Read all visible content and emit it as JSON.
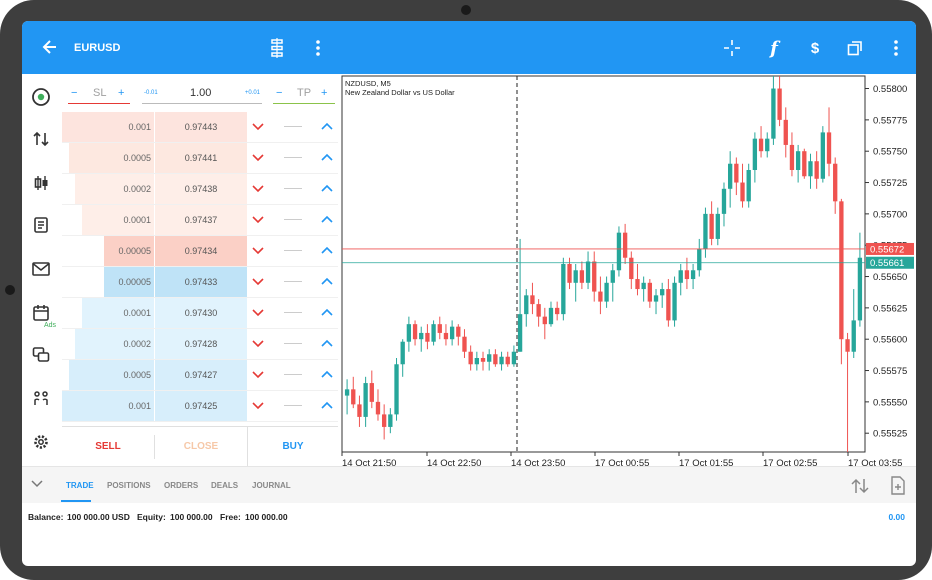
{
  "topbar": {
    "symbol": "EURUSD"
  },
  "sidebar": {
    "ads_label": "Ads"
  },
  "trade": {
    "sl_label": "SL",
    "tp_label": "TP",
    "lot_value": "1.00",
    "lot_minus": "-0.01",
    "lot_plus": "+0.01",
    "rows": [
      {
        "volume": "0.001",
        "price": "0.97443"
      },
      {
        "volume": "0.0005",
        "price": "0.97441"
      },
      {
        "volume": "0.0002",
        "price": "0.97438"
      },
      {
        "volume": "0.0001",
        "price": "0.97437"
      },
      {
        "volume": "0.00005",
        "price": "0.97434"
      },
      {
        "volume": "0.00005",
        "price": "0.97433"
      },
      {
        "volume": "0.0001",
        "price": "0.97430"
      },
      {
        "volume": "0.0002",
        "price": "0.97428"
      },
      {
        "volume": "0.0005",
        "price": "0.97427"
      },
      {
        "volume": "0.001",
        "price": "0.97425"
      }
    ],
    "sell_label": "SELL",
    "close_label": "CLOSE",
    "buy_label": "BUY"
  },
  "chart_data": {
    "type": "candlestick",
    "symbol_line": "NZDUSD, M5",
    "description_line": "New Zealand Dollar vs US Dollar",
    "y_ticks": [
      "0.55800",
      "0.55775",
      "0.55750",
      "0.55725",
      "0.55700",
      "0.55675",
      "0.55650",
      "0.55625",
      "0.55600",
      "0.55575",
      "0.55550",
      "0.55525"
    ],
    "ylim": [
      0.5551,
      0.5581
    ],
    "x_ticks": [
      "14 Oct 21:50",
      "14 Oct 22:50",
      "14 Oct 23:50",
      "17 Oct 00:55",
      "17 Oct 01:55",
      "17 Oct 02:55",
      "17 Oct 03:55"
    ],
    "ask_price": "0.55672",
    "bid_price": "0.55661",
    "up_color": "#26a69a",
    "down_color": "#ef5350",
    "ohlc": [
      [
        0.55555,
        0.55568,
        0.5554,
        0.5556
      ],
      [
        0.5556,
        0.5557,
        0.55545,
        0.55548
      ],
      [
        0.55548,
        0.55555,
        0.5553,
        0.55538
      ],
      [
        0.55538,
        0.5557,
        0.5553,
        0.55565
      ],
      [
        0.55565,
        0.55575,
        0.55545,
        0.5555
      ],
      [
        0.5555,
        0.5556,
        0.55535,
        0.5554
      ],
      [
        0.5554,
        0.55548,
        0.5552,
        0.5553
      ],
      [
        0.5553,
        0.55545,
        0.55525,
        0.5554
      ],
      [
        0.5554,
        0.55585,
        0.55535,
        0.5558
      ],
      [
        0.5558,
        0.556,
        0.5557,
        0.55598
      ],
      [
        0.55598,
        0.55618,
        0.5559,
        0.55612
      ],
      [
        0.55612,
        0.55615,
        0.55595,
        0.556
      ],
      [
        0.556,
        0.5561,
        0.5559,
        0.55605
      ],
      [
        0.55605,
        0.55612,
        0.55592,
        0.55598
      ],
      [
        0.55598,
        0.55615,
        0.55595,
        0.55612
      ],
      [
        0.55612,
        0.55618,
        0.556,
        0.55605
      ],
      [
        0.55605,
        0.55612,
        0.55595,
        0.556
      ],
      [
        0.556,
        0.55615,
        0.55595,
        0.5561
      ],
      [
        0.5561,
        0.55612,
        0.55595,
        0.55602
      ],
      [
        0.55602,
        0.55608,
        0.55585,
        0.5559
      ],
      [
        0.5559,
        0.55595,
        0.55575,
        0.5558
      ],
      [
        0.5558,
        0.5559,
        0.55575,
        0.55585
      ],
      [
        0.55585,
        0.5559,
        0.55575,
        0.55582
      ],
      [
        0.55582,
        0.55592,
        0.55575,
        0.55588
      ],
      [
        0.55588,
        0.55592,
        0.55578,
        0.5558
      ],
      [
        0.5558,
        0.5559,
        0.55575,
        0.55586
      ],
      [
        0.55586,
        0.5559,
        0.55578,
        0.5558
      ],
      [
        0.5558,
        0.55595,
        0.55578,
        0.5559
      ],
      [
        0.5559,
        0.5568,
        0.5559,
        0.5562
      ],
      [
        0.5562,
        0.5564,
        0.5561,
        0.55635
      ],
      [
        0.55635,
        0.55645,
        0.5562,
        0.55628
      ],
      [
        0.55628,
        0.55632,
        0.5561,
        0.55618
      ],
      [
        0.55618,
        0.55625,
        0.556,
        0.55612
      ],
      [
        0.55612,
        0.5563,
        0.5561,
        0.55625
      ],
      [
        0.55625,
        0.5563,
        0.55615,
        0.5562
      ],
      [
        0.5562,
        0.55665,
        0.55615,
        0.5566
      ],
      [
        0.5566,
        0.55665,
        0.5564,
        0.55645
      ],
      [
        0.55645,
        0.5566,
        0.5563,
        0.55655
      ],
      [
        0.55655,
        0.55662,
        0.5564,
        0.55645
      ],
      [
        0.55645,
        0.5567,
        0.5564,
        0.55662
      ],
      [
        0.55662,
        0.5567,
        0.5563,
        0.55638
      ],
      [
        0.55638,
        0.5565,
        0.5562,
        0.5563
      ],
      [
        0.5563,
        0.5565,
        0.55625,
        0.55645
      ],
      [
        0.55645,
        0.5566,
        0.5563,
        0.55655
      ],
      [
        0.55655,
        0.5569,
        0.5565,
        0.55685
      ],
      [
        0.55685,
        0.55692,
        0.5566,
        0.55665
      ],
      [
        0.55665,
        0.5567,
        0.5564,
        0.55648
      ],
      [
        0.55648,
        0.5566,
        0.55635,
        0.5564
      ],
      [
        0.5564,
        0.5565,
        0.5563,
        0.55645
      ],
      [
        0.55645,
        0.55648,
        0.55625,
        0.5563
      ],
      [
        0.5563,
        0.5564,
        0.5562,
        0.55635
      ],
      [
        0.55635,
        0.55645,
        0.55625,
        0.5564
      ],
      [
        0.5564,
        0.55648,
        0.5561,
        0.55615
      ],
      [
        0.55615,
        0.5565,
        0.5561,
        0.55645
      ],
      [
        0.55645,
        0.5566,
        0.55635,
        0.55655
      ],
      [
        0.55655,
        0.55665,
        0.5564,
        0.55648
      ],
      [
        0.55648,
        0.5566,
        0.5564,
        0.55655
      ],
      [
        0.55655,
        0.5568,
        0.5565,
        0.55672
      ],
      [
        0.55672,
        0.55705,
        0.55665,
        0.557
      ],
      [
        0.557,
        0.5571,
        0.55675,
        0.5568
      ],
      [
        0.5568,
        0.55705,
        0.55675,
        0.557
      ],
      [
        0.557,
        0.55725,
        0.5569,
        0.5572
      ],
      [
        0.5572,
        0.5575,
        0.55705,
        0.5574
      ],
      [
        0.5574,
        0.55745,
        0.55715,
        0.55725
      ],
      [
        0.55725,
        0.5574,
        0.55705,
        0.5571
      ],
      [
        0.5571,
        0.5574,
        0.55705,
        0.55735
      ],
      [
        0.55735,
        0.55765,
        0.55725,
        0.5576
      ],
      [
        0.5576,
        0.5577,
        0.55745,
        0.5575
      ],
      [
        0.5575,
        0.55765,
        0.55745,
        0.5576
      ],
      [
        0.5576,
        0.5581,
        0.55755,
        0.558
      ],
      [
        0.558,
        0.5581,
        0.5577,
        0.55775
      ],
      [
        0.55775,
        0.55785,
        0.55745,
        0.55755
      ],
      [
        0.55755,
        0.55765,
        0.5573,
        0.55735
      ],
      [
        0.55735,
        0.55755,
        0.55725,
        0.5575
      ],
      [
        0.5575,
        0.55752,
        0.55728,
        0.5573
      ],
      [
        0.5573,
        0.55748,
        0.5572,
        0.55742
      ],
      [
        0.55742,
        0.5575,
        0.5572,
        0.55728
      ],
      [
        0.55728,
        0.5577,
        0.55725,
        0.55765
      ],
      [
        0.55765,
        0.55785,
        0.5573,
        0.5574
      ],
      [
        0.5574,
        0.55745,
        0.557,
        0.5571
      ],
      [
        0.5571,
        0.55712,
        0.5558,
        0.556
      ],
      [
        0.556,
        0.55605,
        0.5551,
        0.5559
      ],
      [
        0.5559,
        0.5564,
        0.55585,
        0.55615
      ],
      [
        0.55615,
        0.55685,
        0.5561,
        0.55665
      ]
    ]
  },
  "bottom": {
    "tabs": [
      "TRADE",
      "POSITIONS",
      "ORDERS",
      "DEALS",
      "JOURNAL"
    ],
    "balance_label": "Balance:",
    "balance_value": "100 000.00 USD",
    "equity_label": "Equity:",
    "equity_value": "100 000.00",
    "free_label": "Free:",
    "free_value": "100 000.00",
    "profit": "0.00"
  }
}
